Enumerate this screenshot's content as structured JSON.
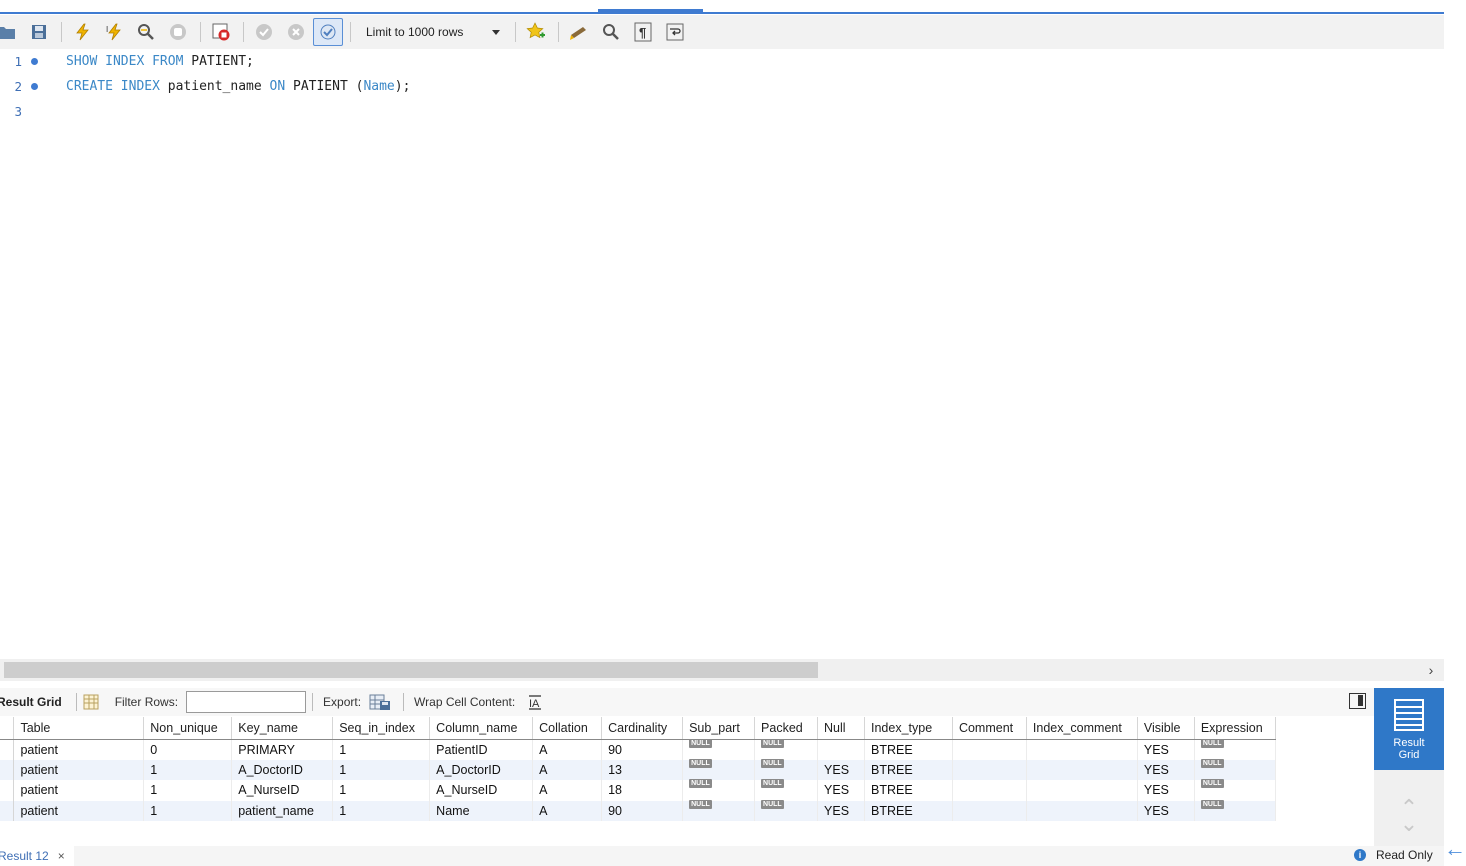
{
  "toolbar": {
    "limit_label": "Limit to 1000 rows",
    "buttons": [
      "open-folder-icon",
      "save-icon",
      "execute-icon",
      "execute-current-icon",
      "explain-icon",
      "stop-icon",
      "stop-on-error-icon",
      "commit-icon",
      "rollback-icon",
      "autocommit-icon"
    ]
  },
  "editor": {
    "lines": [
      {
        "num": "1",
        "has_dot": true
      },
      {
        "num": "2",
        "has_dot": true
      },
      {
        "num": "3",
        "has_dot": false
      }
    ],
    "line1": {
      "kw1": "SHOW",
      "kw2": "INDEX",
      "kw3": "FROM",
      "tail": "PATIENT;"
    },
    "line2": {
      "kw1": "CREATE",
      "kw2": "INDEX",
      "ident": "patient_name",
      "kw3": "ON",
      "table": "PATIENT",
      "open": "(",
      "col": "Name",
      "close": ");"
    }
  },
  "result_toolbar": {
    "title": "Result Grid",
    "filter_label": "Filter Rows:",
    "filter_value": "",
    "export_label": "Export:",
    "wrap_label": "Wrap Cell Content:"
  },
  "side_panel": {
    "result_grid_label_line1": "Result",
    "result_grid_label_line2": "Grid"
  },
  "grid": {
    "columns": [
      "Table",
      "Non_unique",
      "Key_name",
      "Seq_in_index",
      "Column_name",
      "Collation",
      "Cardinality",
      "Sub_part",
      "Packed",
      "Null",
      "Index_type",
      "Comment",
      "Index_comment",
      "Visible",
      "Expression"
    ],
    "rows": [
      [
        "patient",
        "0",
        "PRIMARY",
        "1",
        "PatientID",
        "A",
        "90",
        "NULL",
        "NULL",
        "",
        "BTREE",
        "",
        "",
        "YES",
        "NULL"
      ],
      [
        "patient",
        "1",
        "A_DoctorID",
        "1",
        "A_DoctorID",
        "A",
        "13",
        "NULL",
        "NULL",
        "YES",
        "BTREE",
        "",
        "",
        "YES",
        "NULL"
      ],
      [
        "patient",
        "1",
        "A_NurseID",
        "1",
        "A_NurseID",
        "A",
        "18",
        "NULL",
        "NULL",
        "YES",
        "BTREE",
        "",
        "",
        "YES",
        "NULL"
      ],
      [
        "patient",
        "1",
        "patient_name",
        "1",
        "Name",
        "A",
        "90",
        "NULL",
        "NULL",
        "YES",
        "BTREE",
        "",
        "",
        "YES",
        "NULL"
      ]
    ]
  },
  "bottom": {
    "result_tab": "Result 12",
    "close_glyph": "×",
    "status": "Read Only"
  }
}
